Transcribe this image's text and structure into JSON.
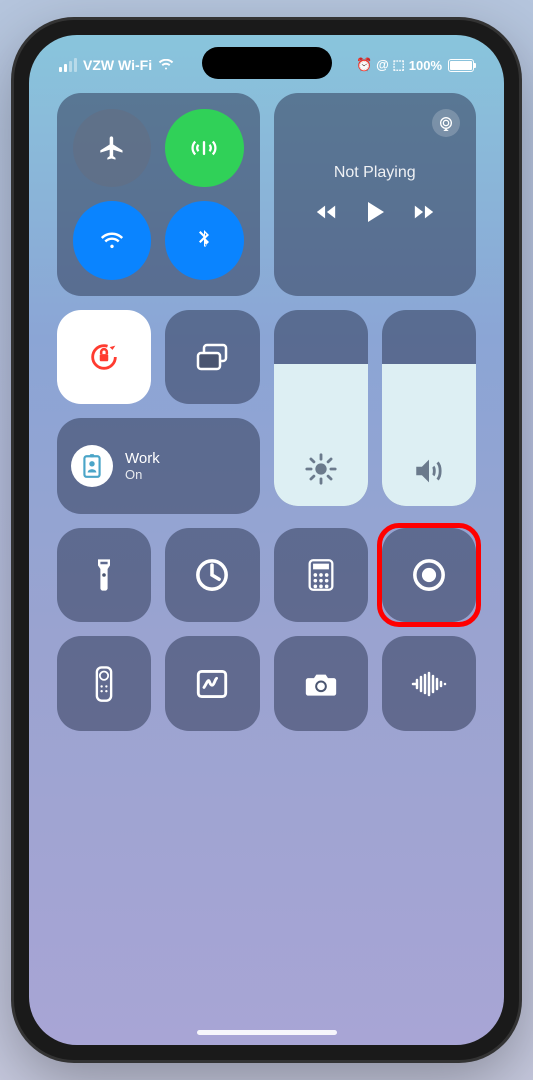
{
  "status": {
    "carrier": "VZW Wi-Fi",
    "battery_percent": "100%",
    "indicators": "⏰ @ ⬚"
  },
  "media": {
    "status": "Not Playing"
  },
  "focus": {
    "title": "Work",
    "status": "On"
  },
  "connectivity": {
    "airplane": false,
    "cellular": true,
    "wifi": true,
    "bluetooth": true
  },
  "sliders": {
    "brightness_percent": 72,
    "volume_percent": 72
  },
  "tiles": {
    "orientation_lock": "locked",
    "screen_mirroring": "screen-mirroring",
    "flashlight": "flashlight",
    "timer": "timer",
    "calculator": "calculator",
    "screen_record": "screen-record",
    "apple_tv_remote": "apple-tv-remote",
    "freeform": "freeform",
    "camera": "camera",
    "voice_memo": "voice-memo"
  }
}
